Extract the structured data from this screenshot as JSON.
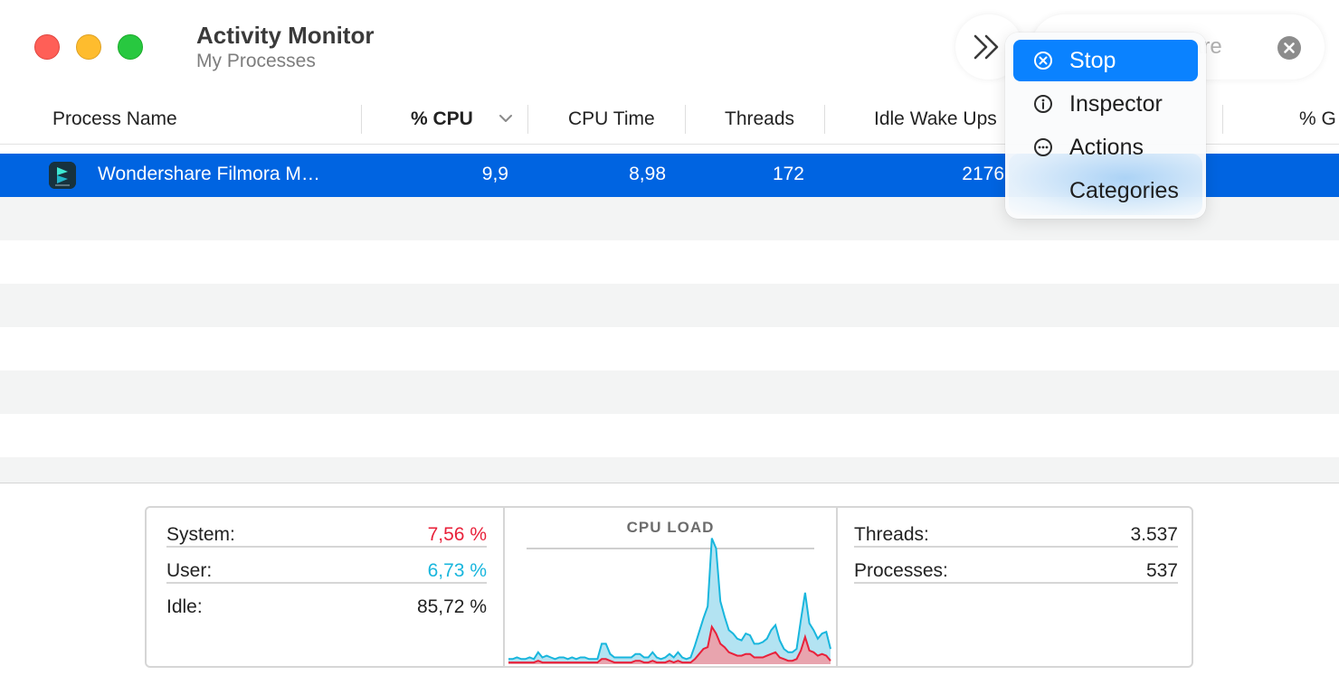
{
  "window": {
    "title": "Activity Monitor",
    "subtitle": "My Processes",
    "search_value": "are"
  },
  "columns": [
    {
      "label": "Process Name"
    },
    {
      "label": "% CPU"
    },
    {
      "label": "CPU Time"
    },
    {
      "label": "Threads"
    },
    {
      "label": "Idle Wake Ups"
    },
    {
      "label": "% G"
    }
  ],
  "processes": [
    {
      "name": "Wondershare Filmora M…",
      "cpu": "9,9",
      "cpu_time": "8,98",
      "threads": "172",
      "idle_wake_ups": "2176",
      "icon": "filmora-app-icon"
    }
  ],
  "menu": {
    "items": [
      {
        "label": "Stop",
        "icon": "stop-icon"
      },
      {
        "label": "Inspector",
        "icon": "info-icon"
      },
      {
        "label": "Actions",
        "icon": "ellipsis-icon"
      },
      {
        "label": "Categories",
        "icon": ""
      }
    ]
  },
  "stats": {
    "system_label": "System:",
    "system_value": "7,56 %",
    "user_label": "User:",
    "user_value": "6,73 %",
    "idle_label": "Idle:",
    "idle_value": "85,72 %",
    "chart_title": "CPU LOAD",
    "threads_label": "Threads:",
    "threads_value": "3.537",
    "processes_label": "Processes:",
    "processes_value": "537",
    "colors": {
      "system": "#e8213a",
      "user": "#18b6dd"
    }
  },
  "cpu_load": {
    "user": [
      2,
      2,
      3,
      2,
      2,
      3,
      2,
      5,
      3,
      4,
      3,
      2,
      3,
      3,
      2,
      3,
      2,
      3,
      3,
      2,
      2,
      2,
      9,
      9,
      4,
      3,
      3,
      3,
      3,
      3,
      4,
      4,
      3,
      3,
      5,
      3,
      2,
      3,
      4,
      3,
      5,
      3,
      2,
      3,
      8,
      13,
      18,
      24,
      52,
      50,
      25,
      18,
      13,
      12,
      10,
      9,
      12,
      11,
      8,
      8,
      9,
      10,
      14,
      16,
      10,
      6,
      5,
      5,
      6,
      18,
      26,
      16,
      13,
      10,
      12,
      14,
      7
    ],
    "system": [
      1,
      1,
      1,
      1,
      1,
      1,
      1,
      2,
      1,
      1,
      1,
      1,
      1,
      1,
      1,
      1,
      1,
      1,
      1,
      1,
      1,
      1,
      3,
      3,
      2,
      1,
      1,
      1,
      1,
      1,
      2,
      2,
      1,
      1,
      2,
      1,
      1,
      1,
      2,
      1,
      2,
      1,
      1,
      1,
      3,
      6,
      9,
      10,
      22,
      18,
      12,
      10,
      7,
      6,
      5,
      5,
      6,
      6,
      4,
      4,
      4,
      5,
      6,
      7,
      4,
      3,
      2,
      2,
      3,
      8,
      16,
      8,
      7,
      5,
      6,
      5,
      2
    ]
  }
}
